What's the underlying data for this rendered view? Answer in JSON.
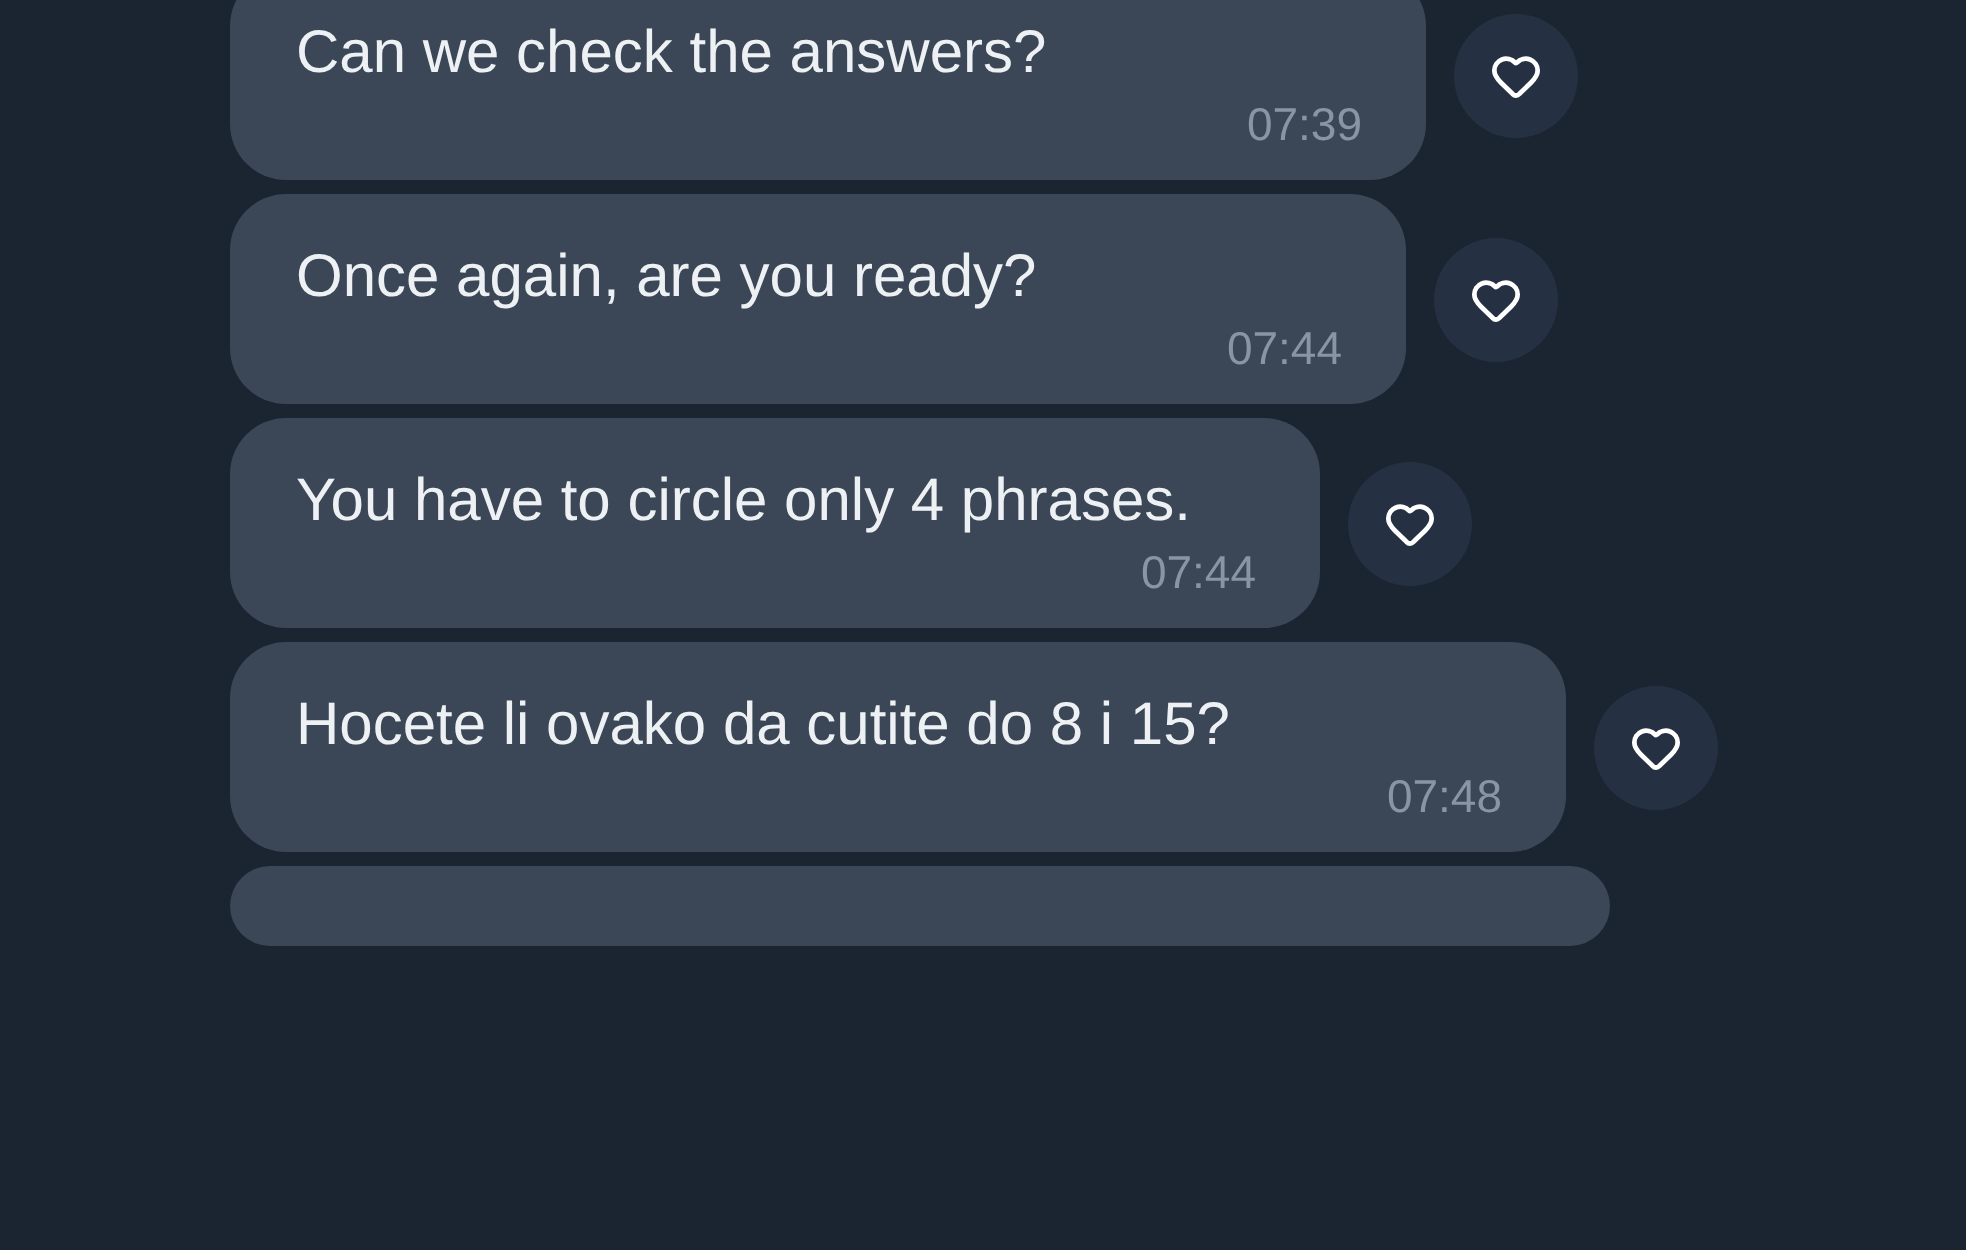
{
  "messages": [
    {
      "text": "Can we check the answers?",
      "time": "07:39",
      "liked": false
    },
    {
      "text": "Once again, are you ready?",
      "time": "07:44",
      "liked": false
    },
    {
      "text": "You have to circle only 4 phrases.",
      "time": "07:44",
      "liked": false
    },
    {
      "text": "Hocete li ovako da cutite do 8 i 15?",
      "time": "07:48",
      "liked": false
    }
  ]
}
